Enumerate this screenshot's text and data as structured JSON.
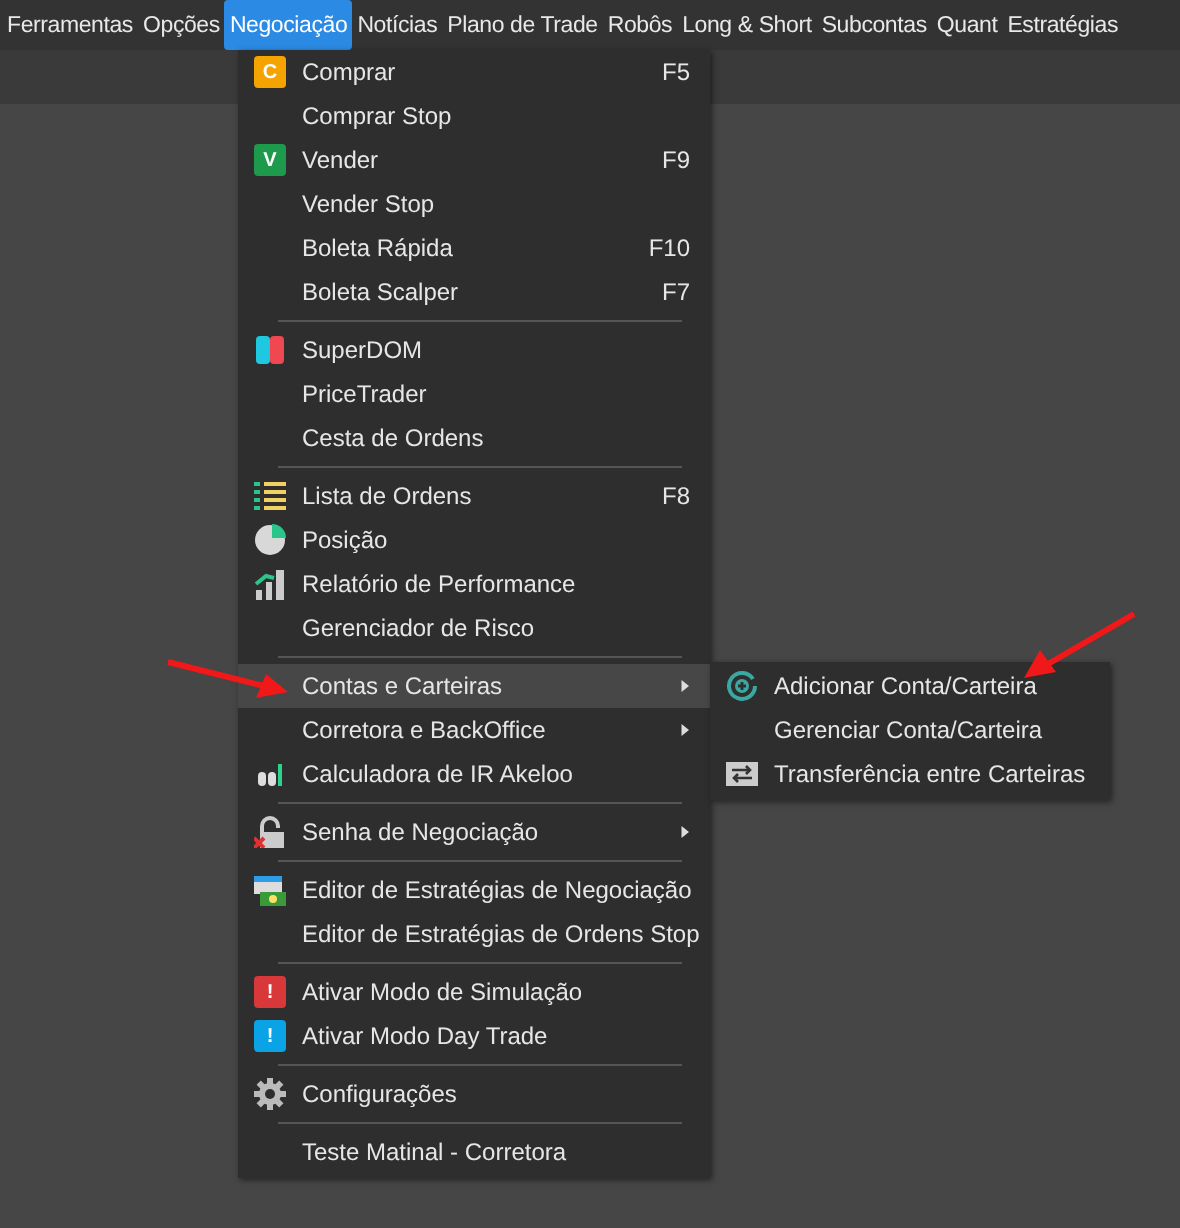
{
  "menu_bar": [
    {
      "label": "Ferramentas",
      "selected": false
    },
    {
      "label": "Opções",
      "selected": false
    },
    {
      "label": "Negociação",
      "selected": true
    },
    {
      "label": "Notícias",
      "selected": false
    },
    {
      "label": "Plano de Trade",
      "selected": false
    },
    {
      "label": "Robôs",
      "selected": false
    },
    {
      "label": "Long & Short",
      "selected": false
    },
    {
      "label": "Subcontas",
      "selected": false
    },
    {
      "label": "Quant",
      "selected": false
    },
    {
      "label": "Estratégias",
      "selected": false
    }
  ],
  "menu": [
    {
      "kind": "badge",
      "label": "Comprar",
      "badge": "C",
      "color": "#f5a300",
      "shortcut": "F5",
      "submenu": false,
      "selected": false
    },
    {
      "kind": "plain",
      "label": "Comprar Stop",
      "submenu": false,
      "selected": false
    },
    {
      "kind": "badge",
      "label": "Vender",
      "badge": "V",
      "color": "#1e9a4c",
      "shortcut": "F9",
      "submenu": false,
      "selected": false
    },
    {
      "kind": "plain",
      "label": "Vender Stop",
      "submenu": false,
      "selected": false
    },
    {
      "kind": "plain",
      "label": "Boleta Rápida",
      "shortcut": "F10",
      "submenu": false,
      "selected": false
    },
    {
      "kind": "plain",
      "label": "Boleta Scalper",
      "shortcut": "F7",
      "submenu": false,
      "selected": false
    },
    {
      "kind": "separator"
    },
    {
      "kind": "dom",
      "label": "SuperDOM",
      "submenu": false,
      "selected": false
    },
    {
      "kind": "plain",
      "label": "PriceTrader",
      "submenu": false,
      "selected": false
    },
    {
      "kind": "plain",
      "label": "Cesta de Ordens",
      "submenu": false,
      "selected": false
    },
    {
      "kind": "separator"
    },
    {
      "kind": "list",
      "label": "Lista de Ordens",
      "shortcut": "F8",
      "submenu": false,
      "selected": false
    },
    {
      "kind": "pie",
      "label": "Posição",
      "submenu": false,
      "selected": false
    },
    {
      "kind": "bars",
      "label": "Relatório de Performance",
      "submenu": false,
      "selected": false
    },
    {
      "kind": "plain",
      "label": "Gerenciador de Risco",
      "submenu": false,
      "selected": false
    },
    {
      "kind": "separator"
    },
    {
      "kind": "plain",
      "label": "Contas e Carteiras",
      "submenu": true,
      "selected": true
    },
    {
      "kind": "plain",
      "label": "Corretora e BackOffice",
      "submenu": true,
      "selected": false
    },
    {
      "kind": "akl",
      "label": "Calculadora de IR Akeloo",
      "submenu": false,
      "selected": false
    },
    {
      "kind": "separator"
    },
    {
      "kind": "lock",
      "label": "Senha de Negociação",
      "submenu": true,
      "selected": false
    },
    {
      "kind": "separator"
    },
    {
      "kind": "editor",
      "label": "Editor de Estratégias de Negociação",
      "submenu": false,
      "selected": false
    },
    {
      "kind": "plain",
      "label": "Editor de Estratégias de Ordens Stop",
      "submenu": false,
      "selected": false
    },
    {
      "kind": "separator"
    },
    {
      "kind": "badge",
      "label": "Ativar Modo de Simulação",
      "badge": "!",
      "color": "#d9383a",
      "submenu": false,
      "selected": false
    },
    {
      "kind": "badge",
      "label": "Ativar Modo Day Trade",
      "badge": "!",
      "color": "#0aa3e6",
      "submenu": false,
      "selected": false
    },
    {
      "kind": "separator"
    },
    {
      "kind": "gear",
      "label": "Configurações",
      "submenu": false,
      "selected": false
    },
    {
      "kind": "separator"
    },
    {
      "kind": "plain",
      "label": "Teste Matinal - Corretora",
      "submenu": false,
      "selected": false
    }
  ],
  "submenu": [
    {
      "kind": "plus",
      "label": "Adicionar Conta/Carteira"
    },
    {
      "kind": "plain",
      "label": "Gerenciar Conta/Carteira"
    },
    {
      "kind": "transfer",
      "label": "Transferência entre Carteiras"
    }
  ]
}
